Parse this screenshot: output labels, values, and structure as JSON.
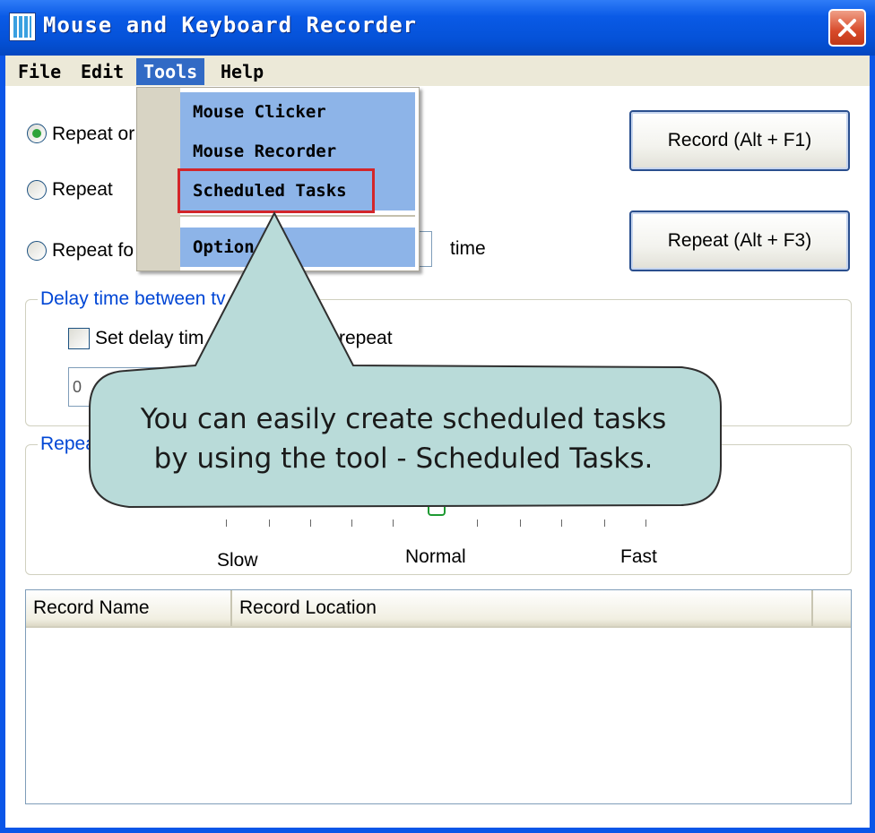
{
  "window": {
    "title": "Mouse and Keyboard Recorder"
  },
  "menubar": {
    "items": [
      {
        "label": "File"
      },
      {
        "label": "Edit"
      },
      {
        "label": "Tools"
      },
      {
        "label": "Help"
      }
    ]
  },
  "tools_menu": {
    "items": [
      {
        "label": "Mouse Clicker"
      },
      {
        "label": "Mouse Recorder"
      },
      {
        "label": "Scheduled Tasks"
      },
      {
        "label": "Option"
      }
    ],
    "highlighted": "Scheduled Tasks"
  },
  "repeat_options": {
    "option1": {
      "label": "Repeat or",
      "checked": true
    },
    "option2": {
      "label": "Repeat",
      "checked": false
    },
    "option3": {
      "label": "Repeat fo",
      "checked": false
    },
    "time_suffix": "time"
  },
  "buttons": {
    "record": "Record (Alt + F1)",
    "repeat": "Repeat (Alt + F3)"
  },
  "delay_group": {
    "title": "Delay time between tv",
    "checkbox_label_left": "Set delay tim",
    "checkbox_label_right": "repeat",
    "checked": false,
    "input_value": "0"
  },
  "speed_group": {
    "title": "Repea",
    "labels": {
      "slow": "Slow",
      "normal": "Normal",
      "fast": "Fast"
    },
    "position": "Normal"
  },
  "records_table": {
    "columns": [
      "Record Name",
      "Record Location"
    ],
    "rows": []
  },
  "callout": {
    "text_line1": "You can easily create scheduled tasks",
    "text_line2": "by using the tool - Scheduled Tasks.",
    "fill_color": "#b9dbd9",
    "border_color": "#2f2f2f"
  },
  "colors": {
    "titlebar": "#0552d8",
    "menu_highlight": "#316ac5",
    "dropdown_item": "#8db4e8",
    "highlight_border": "#d3262a",
    "group_title": "#0046d5"
  }
}
